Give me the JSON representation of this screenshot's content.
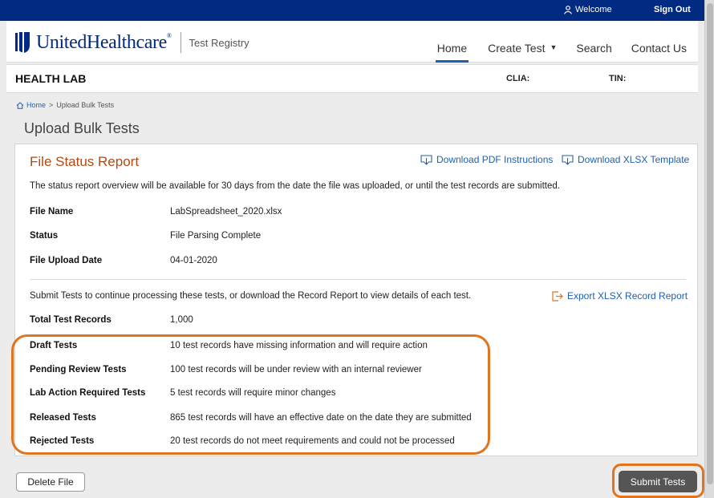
{
  "topbar": {
    "welcome": "Welcome",
    "signout": "Sign Out"
  },
  "header": {
    "brand": "UnitedHealthcare",
    "brand_reg": "®",
    "product": "Test Registry",
    "nav": {
      "home": "Home",
      "create_test": "Create Test",
      "search": "Search",
      "contact_us": "Contact Us"
    }
  },
  "labbar": {
    "lab_name": "HEALTH LAB",
    "clia_label": "CLIA:",
    "tin_label": "TIN:"
  },
  "breadcrumb": {
    "home": "Home",
    "separator": ">",
    "current": "Upload Bulk Tests"
  },
  "page_title": "Upload Bulk Tests",
  "report": {
    "title": "File Status Report",
    "download_pdf": "Download PDF Instructions",
    "download_xlsx": "Download XLSX Template",
    "note": "The status report overview will be available for 30 days from the date the file was uploaded, or until the test records are submitted.",
    "file_name_label": "File Name",
    "file_name": "LabSpreadsheet_2020.xlsx",
    "status_label": "Status",
    "status": "File Parsing Complete",
    "upload_date_label": "File Upload Date",
    "upload_date": "04-01-2020",
    "submit_note": "Submit Tests to continue processing these tests, or download the Record Report to view details of each test.",
    "export": "Export XLSX Record Report",
    "total_label": "Total Test Records",
    "total": "1,000",
    "categories": [
      {
        "label": "Draft Tests",
        "desc": "10 test records have missing information and will require action"
      },
      {
        "label": "Pending Review Tests",
        "desc": "100 test records will be under review with an internal reviewer"
      },
      {
        "label": "Lab Action Required Tests",
        "desc": "5 test records will require minor changes"
      },
      {
        "label": "Released Tests",
        "desc": "865 test records will have an effective date on the date they are submitted"
      },
      {
        "label": "Rejected Tests",
        "desc": "20 test records do not meet requirements and could not be processed"
      }
    ]
  },
  "actions": {
    "delete": "Delete File",
    "submit": "Submit Tests"
  },
  "colors": {
    "topbar": "#012a83",
    "link": "#1f5fb0",
    "title_accent": "#b14a12",
    "highlight": "#e0741f",
    "submit_button": "#555555"
  }
}
